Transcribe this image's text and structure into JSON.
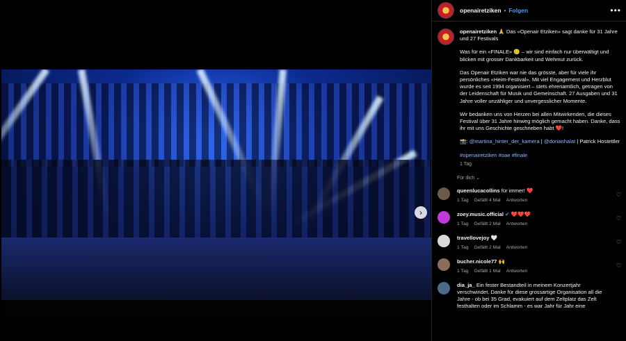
{
  "post": {
    "username": "openairetziken",
    "follow_label": "Folgen",
    "dot": "•",
    "more": "•••",
    "caption_lead": "🙏 Das «Openair Etziken» sagt danke für 31 Jahre und 27 Festivals",
    "paragraphs": [
      "Was für ein «FINALE» 🥲 – wir sind einfach nur überwältigt und blicken mit grosser Dankbarkeit und Wehmut zurück.",
      "Das Openair Etziken war nie das grösste, aber für viele ihr persönliches «Heim-Festival». Mit viel Engagement und Herzblut wurde es seit 1994 organisiert – stets ehrenamtlich, getragen von der Leidenschaft für Musik und Gemeinschaft. 27 Ausgaben und 31 Jahre voller unzähliger und unvergesslicher Momente.",
      "Wir bedanken uns von Herzen bei allen Mitwirkenden, die dieses Festival über 31 Jahre hinweg möglich gemacht haben. Danke, dass ihr mit uns Geschichte geschrieben habt ❤️!"
    ],
    "credits_prefix": "📸: ",
    "credit_1": "@martina_hinter_der_kamera",
    "credit_sep": " | ",
    "credit_2": "@dorianhalat",
    "credit_3": " | Patrick Hostettler",
    "hashtags": "#openairetziken #oae #finale",
    "time": "1 Tag",
    "hidden_replies": "Für dich ⌄"
  },
  "comments": [
    {
      "user": "queenlucacollins",
      "text": "für immer! ❤️",
      "time": "1 Tag",
      "likes": "Gefällt 4 Mal",
      "reply": "Antworten",
      "color": "#6b5a4a"
    },
    {
      "user": "zoey.music.official",
      "text": "❤️❤️❤️",
      "time": "1 Tag",
      "likes": "Gefällt 2 Mal",
      "reply": "Antworten",
      "color": "#c03ad8"
    },
    {
      "user": "travellovejoy",
      "text": "🤍",
      "time": "1 Tag",
      "likes": "Gefällt 2 Mal",
      "reply": "Antworten",
      "color": "#d9d9d9"
    },
    {
      "user": "bucher.nicole77",
      "text": "🙌",
      "time": "1 Tag",
      "likes": "Gefällt 1 Mal",
      "reply": "Antworten",
      "color": "#8a6d5a"
    },
    {
      "user": "dia_ja_",
      "text": "Ein fester Bestandteil in meinem Konzertjahr verschwindet. Danke für diese grossartige Organisation all die Jahre - ob bei 35 Grad, evakuiert auf dem Zeltplatz das Zelt festhalten oder im Schlamm - es war Jahr für Jahr eine",
      "time": "",
      "likes": "",
      "reply": "",
      "color": "#4a6a8a"
    }
  ],
  "icons": {
    "heart": "heart-icon",
    "next": "chevron-right-icon",
    "verified": "verified-icon"
  },
  "ui": {
    "next_arrow": "›",
    "heart": "♡",
    "verified": "✔"
  }
}
